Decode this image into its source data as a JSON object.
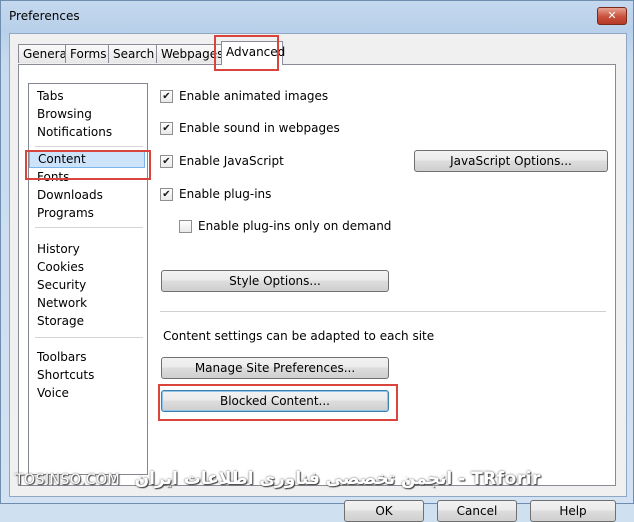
{
  "window": {
    "title": "Preferences",
    "close_glyph": "✕"
  },
  "tabs": [
    {
      "label": "General"
    },
    {
      "label": "Forms"
    },
    {
      "label": "Search"
    },
    {
      "label": "Webpages"
    },
    {
      "label": "Advanced",
      "active": true
    }
  ],
  "categories": {
    "group1": [
      "Tabs",
      "Browsing",
      "Notifications"
    ],
    "group2": [
      "Content",
      "Fonts",
      "Downloads",
      "Programs"
    ],
    "group3": [
      "History",
      "Cookies",
      "Security",
      "Network",
      "Storage"
    ],
    "group4": [
      "Toolbars",
      "Shortcuts",
      "Voice"
    ],
    "selected": "Content"
  },
  "options": {
    "animated_images": {
      "label": "Enable animated images",
      "checked": true
    },
    "sound": {
      "label": "Enable sound in webpages",
      "checked": true
    },
    "javascript": {
      "label": "Enable JavaScript",
      "checked": true
    },
    "plugins": {
      "label": "Enable plug-ins",
      "checked": true
    },
    "plugins_on_demand": {
      "label": "Enable plug-ins only on demand",
      "checked": false
    }
  },
  "buttons": {
    "javascript_options": "JavaScript Options...",
    "style_options": "Style Options...",
    "manage_site_prefs": "Manage Site Preferences...",
    "blocked_content": "Blocked Content...",
    "ok": "OK",
    "cancel": "Cancel",
    "help": "Help"
  },
  "content_settings_text": "Content settings can be adapted to each site",
  "watermark": {
    "site": "TOSINSO.COM",
    "text": "انجمن تخصصی فناوری اطلاعات ایران - TRforir"
  },
  "colors": {
    "highlight": "#d9453d",
    "selection": "#cde3fa"
  }
}
